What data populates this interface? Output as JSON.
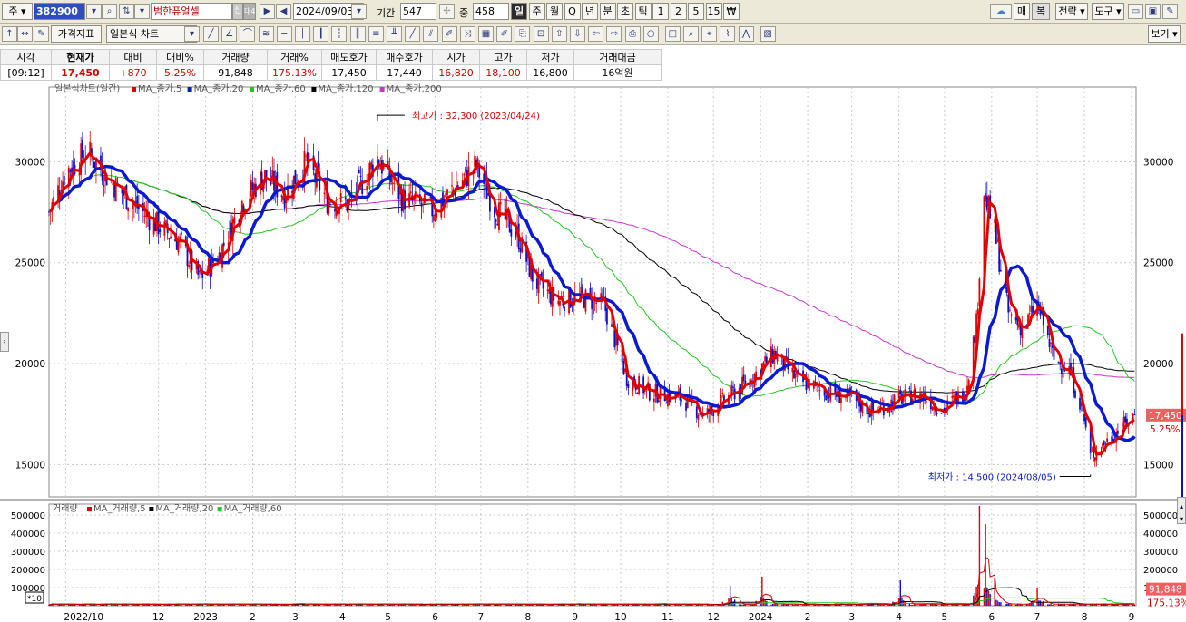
{
  "toolbar1": {
    "market_label": "주",
    "code": "382900",
    "name": "범한퓨얼셀",
    "badge_credit": "신",
    "badge_other": "대40",
    "date": "2024/09/03",
    "period_label": "기간",
    "period_value": "547",
    "zoom_label": "중",
    "zoom_value": "458",
    "timeframes": [
      "일",
      "주",
      "월",
      "Q",
      "년",
      "분",
      "초",
      "틱",
      "1",
      "2",
      "5",
      "15",
      "₩"
    ],
    "selected_timeframe": "일",
    "right_buttons": [
      "매",
      "복",
      "전략",
      "도구",
      "보기"
    ]
  },
  "toolbar2": {
    "indicator_button": "가격지표",
    "chart_type": "일본식 차트"
  },
  "quote": {
    "headers": [
      "시각",
      "현재가",
      "대비",
      "대비%",
      "거래량",
      "거래%",
      "매도호가",
      "매수호가",
      "시가",
      "고가",
      "저가",
      "거래대금"
    ],
    "values": [
      "[09:12]",
      "17,450",
      "+870",
      "5.25%",
      "91,848",
      "175.13%",
      "17,450",
      "17,440",
      "16,820",
      "18,100",
      "16,800",
      "16억원"
    ]
  },
  "colors": {
    "up": "#e00000",
    "down": "#1010c8",
    "ma5": "#e00000",
    "ma20": "#0a1ad0",
    "ma60": "#22c822",
    "ma120": "#000000",
    "ma200": "#cc33cc",
    "current_price_box": "#f06060"
  },
  "chart_data": [
    {
      "type": "candlestick",
      "legend_title": "일본식차트(일간)",
      "legend": [
        {
          "name": "MA_종가,5",
          "color": "#e00000"
        },
        {
          "name": "MA_종가,20",
          "color": "#0a1ad0"
        },
        {
          "name": "MA_종가,60",
          "color": "#22c822"
        },
        {
          "name": "MA_종가,120",
          "color": "#000000"
        },
        {
          "name": "MA_종가,200",
          "color": "#cc33cc"
        }
      ],
      "y_ticks": [
        15000,
        20000,
        25000,
        30000
      ],
      "ylim": [
        13400,
        33700
      ],
      "x_ticks": [
        "2022/10",
        "12",
        "2023",
        "2",
        "3",
        "4",
        "5",
        "6",
        "7",
        "8",
        "9",
        "10",
        "11",
        "12",
        "2024",
        "2",
        "3",
        "4",
        "5",
        "6",
        "7",
        "8",
        "9"
      ],
      "price_path": [
        {
          "date": "2022-09-20",
          "close": 27500
        },
        {
          "date": "2022-10-01",
          "close": 29500
        },
        {
          "date": "2022-10-15",
          "close": 30500
        },
        {
          "date": "2022-11-05",
          "close": 28600
        },
        {
          "date": "2022-11-25",
          "close": 27200
        },
        {
          "date": "2022-12-15",
          "close": 26000
        },
        {
          "date": "2022-12-28",
          "close": 24200
        },
        {
          "date": "2023-01-10",
          "close": 25400
        },
        {
          "date": "2023-01-25",
          "close": 28000
        },
        {
          "date": "2023-02-08",
          "close": 29300
        },
        {
          "date": "2023-02-22",
          "close": 28400
        },
        {
          "date": "2023-03-08",
          "close": 30000
        },
        {
          "date": "2023-03-22",
          "close": 28100
        },
        {
          "date": "2023-04-05",
          "close": 27900
        },
        {
          "date": "2023-04-24",
          "close": 30200
        },
        {
          "date": "2023-05-10",
          "close": 28200
        },
        {
          "date": "2023-05-30",
          "close": 27600
        },
        {
          "date": "2023-06-15",
          "close": 28800
        },
        {
          "date": "2023-06-28",
          "close": 29800
        },
        {
          "date": "2023-07-10",
          "close": 27700
        },
        {
          "date": "2023-07-25",
          "close": 26400
        },
        {
          "date": "2023-08-05",
          "close": 24100
        },
        {
          "date": "2023-08-20",
          "close": 23100
        },
        {
          "date": "2023-09-05",
          "close": 23300
        },
        {
          "date": "2023-09-20",
          "close": 22900
        },
        {
          "date": "2023-10-05",
          "close": 19300
        },
        {
          "date": "2023-10-20",
          "close": 18600
        },
        {
          "date": "2023-11-10",
          "close": 18300
        },
        {
          "date": "2023-11-25",
          "close": 17400
        },
        {
          "date": "2023-12-10",
          "close": 18300
        },
        {
          "date": "2023-12-25",
          "close": 19200
        },
        {
          "date": "2024-01-10",
          "close": 20500
        },
        {
          "date": "2024-01-25",
          "close": 19200
        },
        {
          "date": "2024-02-10",
          "close": 18700
        },
        {
          "date": "2024-02-28",
          "close": 18300
        },
        {
          "date": "2024-03-15",
          "close": 17600
        },
        {
          "date": "2024-03-30",
          "close": 18200
        },
        {
          "date": "2024-04-15",
          "close": 18500
        },
        {
          "date": "2024-04-30",
          "close": 17700
        },
        {
          "date": "2024-05-15",
          "close": 18700
        },
        {
          "date": "2024-05-22",
          "close": 22000
        },
        {
          "date": "2024-05-27",
          "close": 28500
        },
        {
          "date": "2024-06-03",
          "close": 26500
        },
        {
          "date": "2024-06-12",
          "close": 22500
        },
        {
          "date": "2024-06-22",
          "close": 21700
        },
        {
          "date": "2024-07-01",
          "close": 23000
        },
        {
          "date": "2024-07-12",
          "close": 20200
        },
        {
          "date": "2024-07-22",
          "close": 19700
        },
        {
          "date": "2024-07-31",
          "close": 17600
        },
        {
          "date": "2024-08-05",
          "close": 15400
        },
        {
          "date": "2024-08-15",
          "close": 16100
        },
        {
          "date": "2024-08-25",
          "close": 16800
        },
        {
          "date": "2024-09-03",
          "close": 17450
        }
      ],
      "high_marker": {
        "label": "최고가 : 32,300 (2023/04/24)",
        "value": 32300,
        "date": "2023-04-24"
      },
      "low_marker": {
        "label": "최저가 : 14,500 (2024/08/05)",
        "value": 14500,
        "date": "2024-08-05"
      },
      "current_price_label": "17,450",
      "current_change_label": "5.25%"
    },
    {
      "type": "bar",
      "legend_title": "거래량",
      "legend": [
        {
          "name": "MA_거래량,5",
          "color": "#e00000"
        },
        {
          "name": "MA_거래량,20",
          "color": "#000000"
        },
        {
          "name": "MA_거래량,60",
          "color": "#22c822"
        }
      ],
      "y_ticks": [
        100000,
        200000,
        300000,
        400000,
        500000
      ],
      "y_tick_labels": [
        "100000",
        "200000",
        "300000",
        "400000",
        "500000"
      ],
      "ylim": [
        0,
        560000
      ],
      "unit_label": "*10",
      "current_volume_label": "91,848",
      "current_volume_pct_label": "175.13%",
      "volume_peaks": [
        {
          "date": "2023-12-12",
          "volume": 110000
        },
        {
          "date": "2024-01-02",
          "volume": 160000
        },
        {
          "date": "2024-04-02",
          "volume": 140000
        },
        {
          "date": "2024-05-24",
          "volume": 550000
        },
        {
          "date": "2024-05-28",
          "volume": 450000
        },
        {
          "date": "2024-06-03",
          "volume": 150000
        },
        {
          "date": "2024-07-01",
          "volume": 100000
        }
      ]
    }
  ]
}
